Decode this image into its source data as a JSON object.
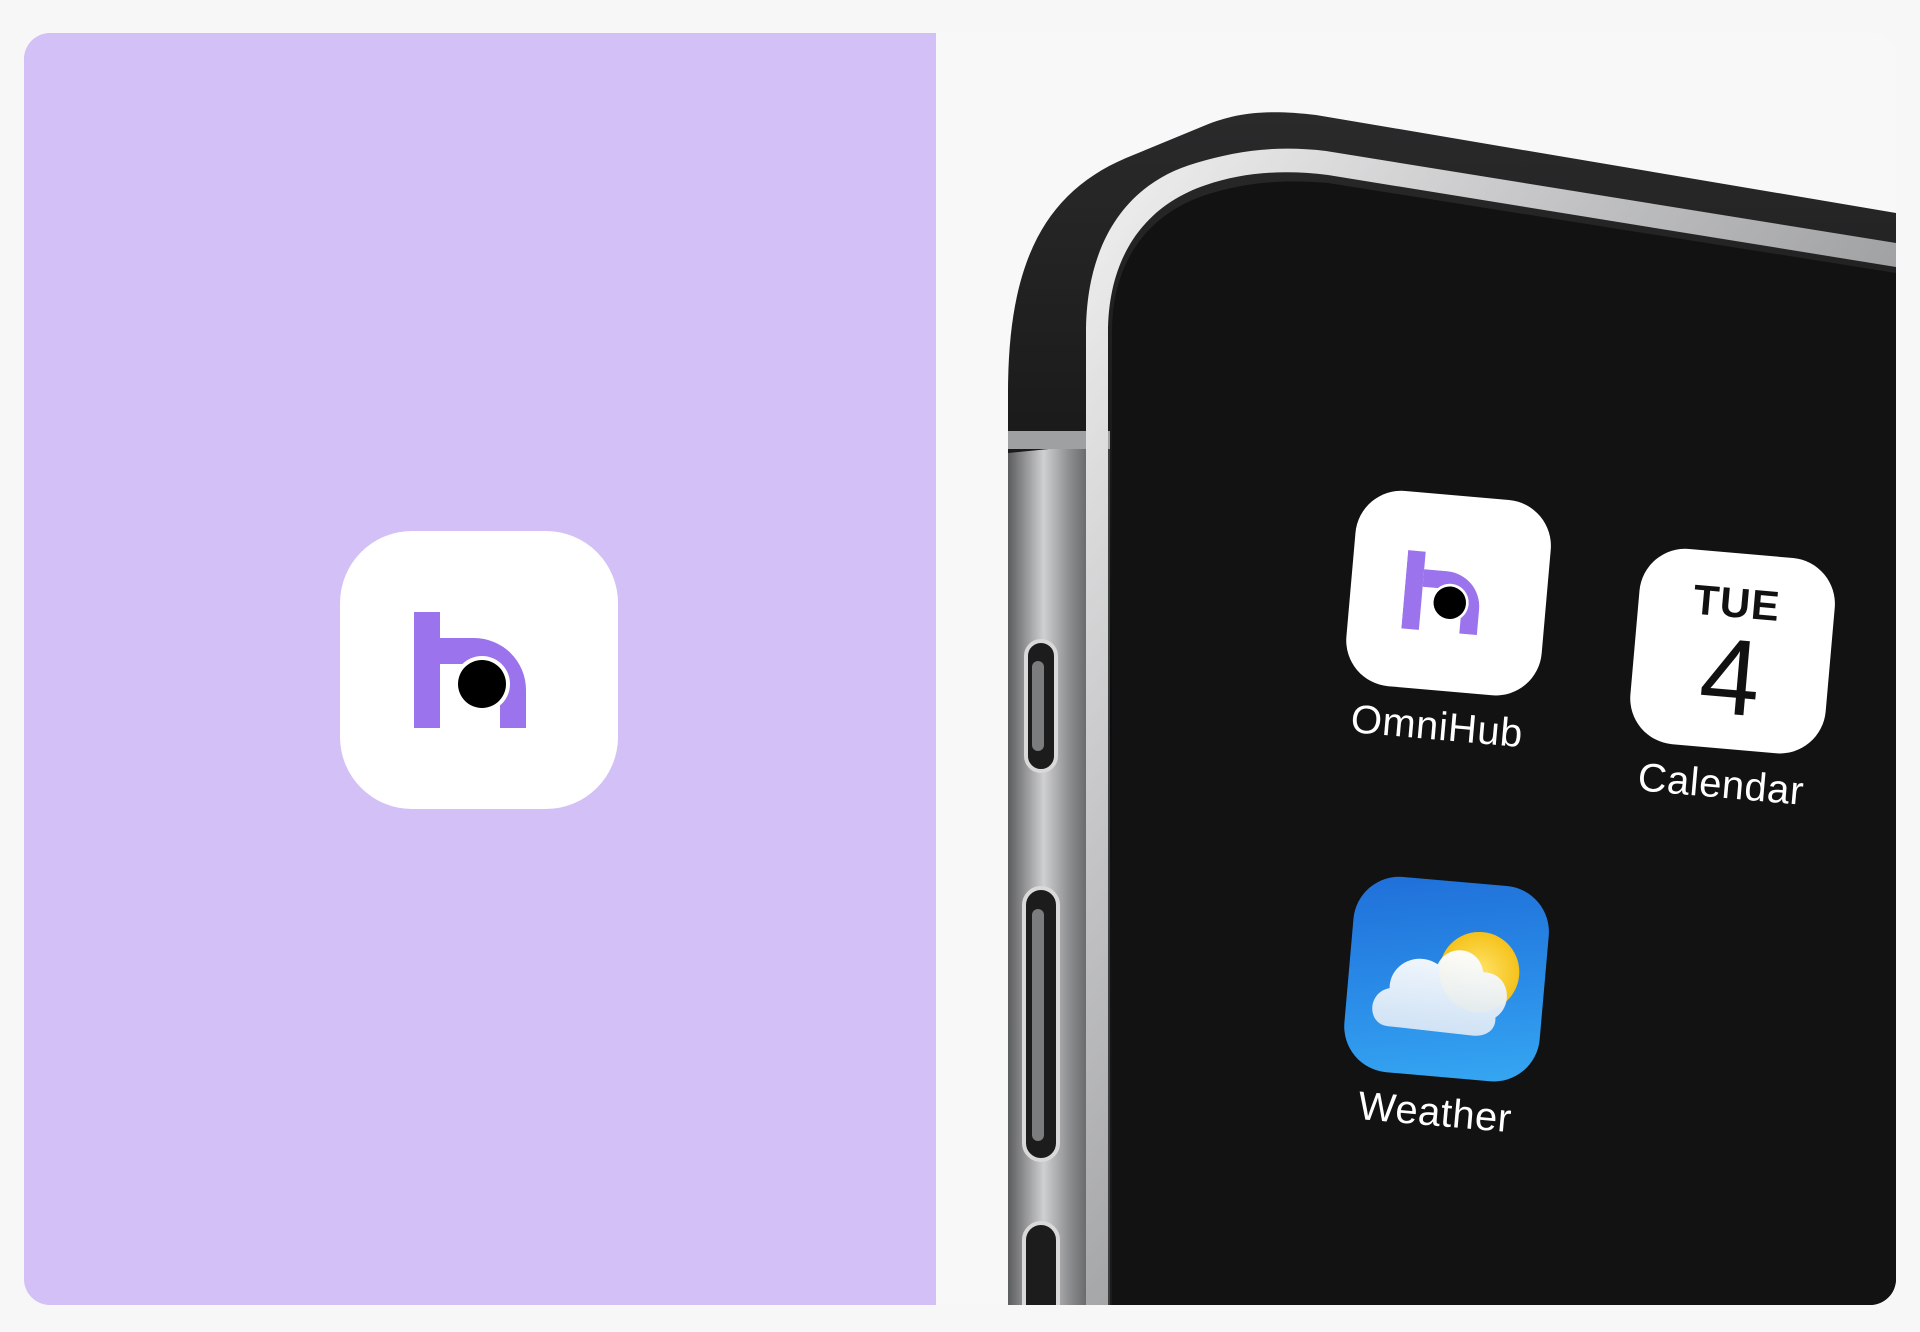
{
  "left_panel": {
    "background": "#d2c0f6",
    "app_icon": {
      "name": "omnihub-logo-icon",
      "accent": "#9b73ec"
    }
  },
  "phone": {
    "home_screen": {
      "apps": [
        {
          "label": "OmniHub",
          "icon": "omnihub-logo-icon"
        },
        {
          "label": "Calendar",
          "icon": "calendar-icon",
          "day": "TUE",
          "date": "4"
        },
        {
          "label": "Weather",
          "icon": "weather-cloud-sun-icon"
        }
      ]
    }
  },
  "colors": {
    "brand_purple": "#9b73ec",
    "screen_black": "#121212",
    "frame_steel": "#6d6e70"
  }
}
